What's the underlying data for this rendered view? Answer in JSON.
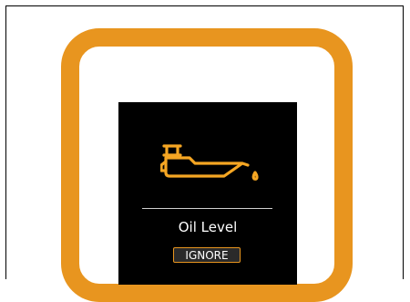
{
  "warning": {
    "icon": "oil-can-icon",
    "icon_color": "#f5a623",
    "title": "Oil Level",
    "ignore_label": "IGNORE"
  },
  "colors": {
    "bezel": "#e8951f",
    "screen": "#000000",
    "accent": "#e8951f"
  }
}
